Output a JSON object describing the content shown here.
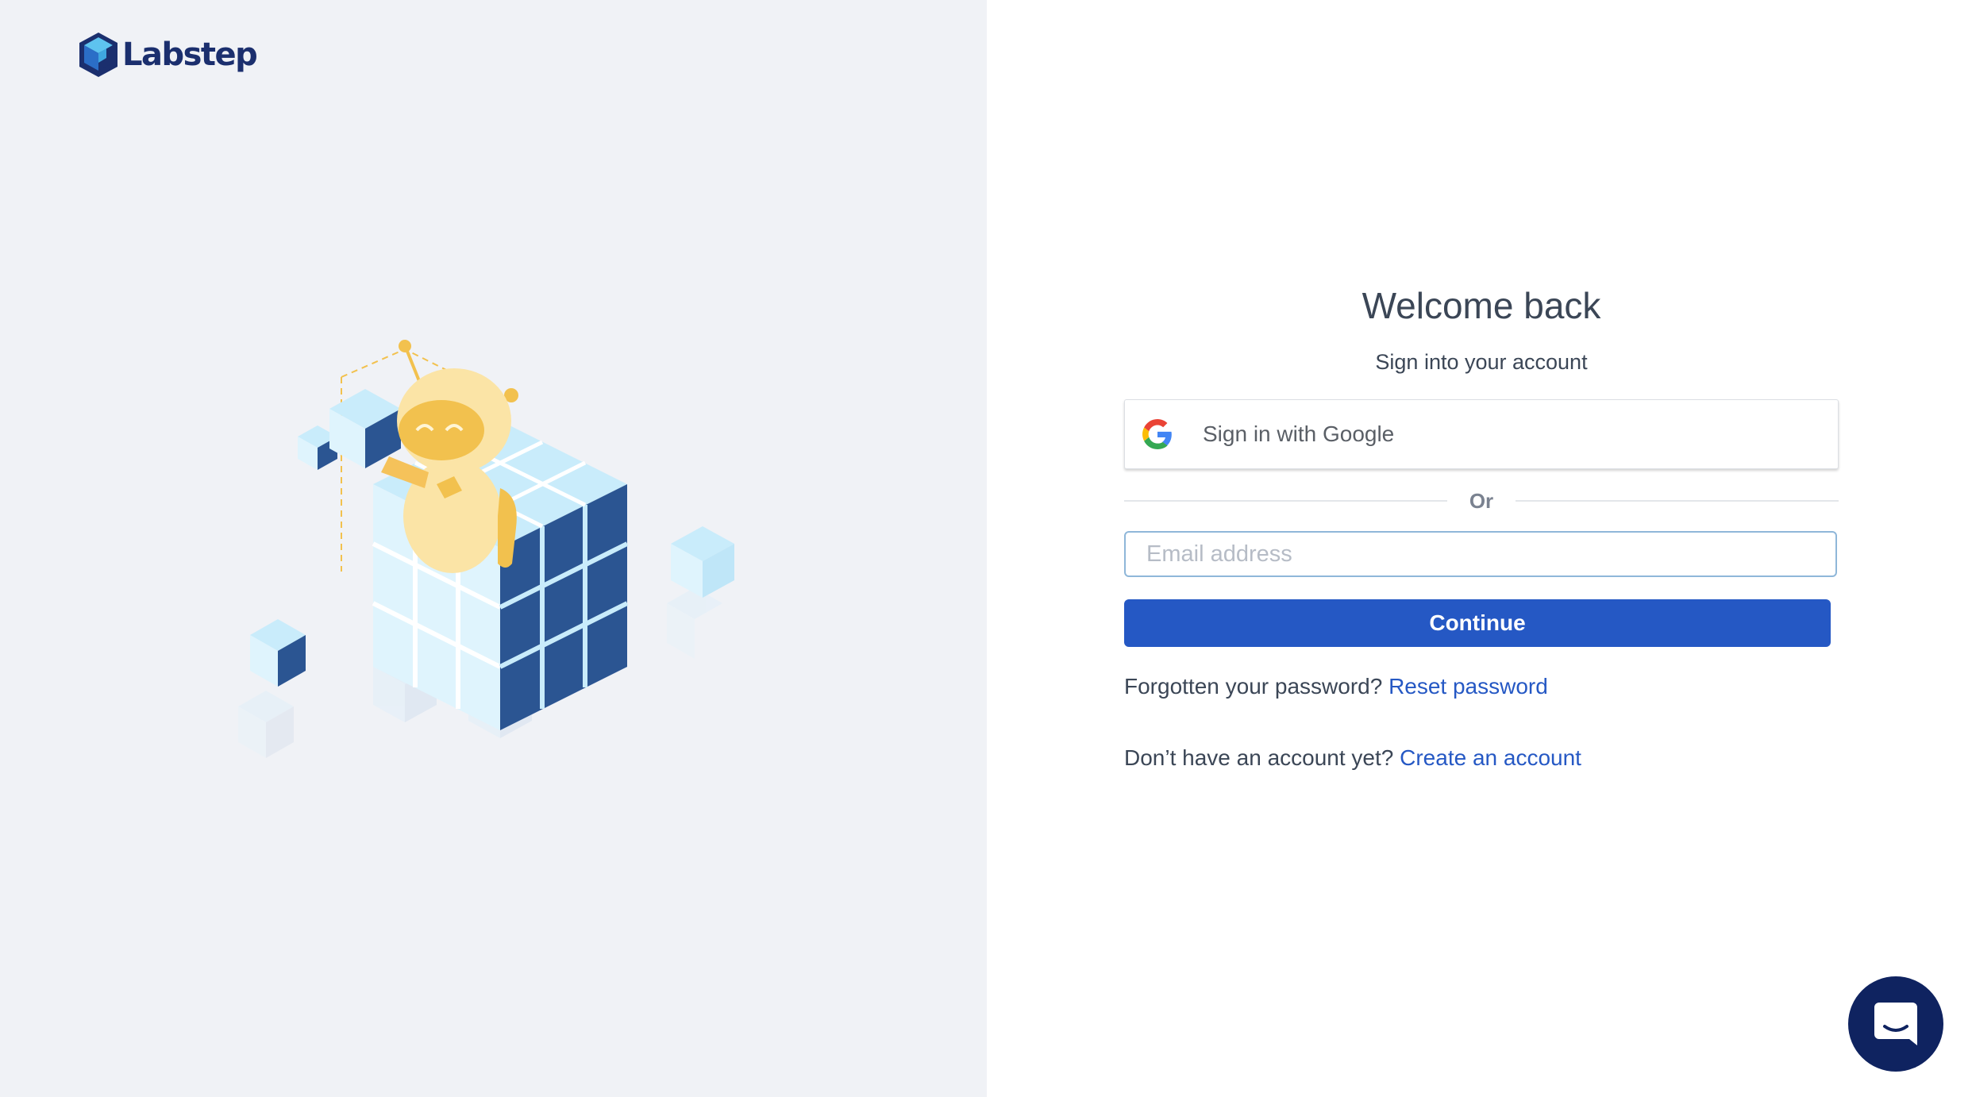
{
  "brand": {
    "name": "Labstep",
    "logo_color": "#1b2f6e"
  },
  "illustration": {
    "icon": "robot-on-cubes-illustration"
  },
  "login": {
    "title": "Welcome back",
    "subtitle": "Sign into your account",
    "google_button_label": "Sign in with Google",
    "divider_text": "Or",
    "email_placeholder": "Email address",
    "email_value": "",
    "continue_label": "Continue",
    "forgot_text": "Forgotten your password?",
    "reset_link": "Reset password",
    "no_account_text": "Don’t have an account yet?",
    "create_link": "Create an account"
  },
  "colors": {
    "primary": "#2558c4",
    "left_panel_bg": "#f0f2f6",
    "chat_bg": "#0f2360"
  },
  "chat": {
    "icon": "chat-bubble-icon"
  }
}
